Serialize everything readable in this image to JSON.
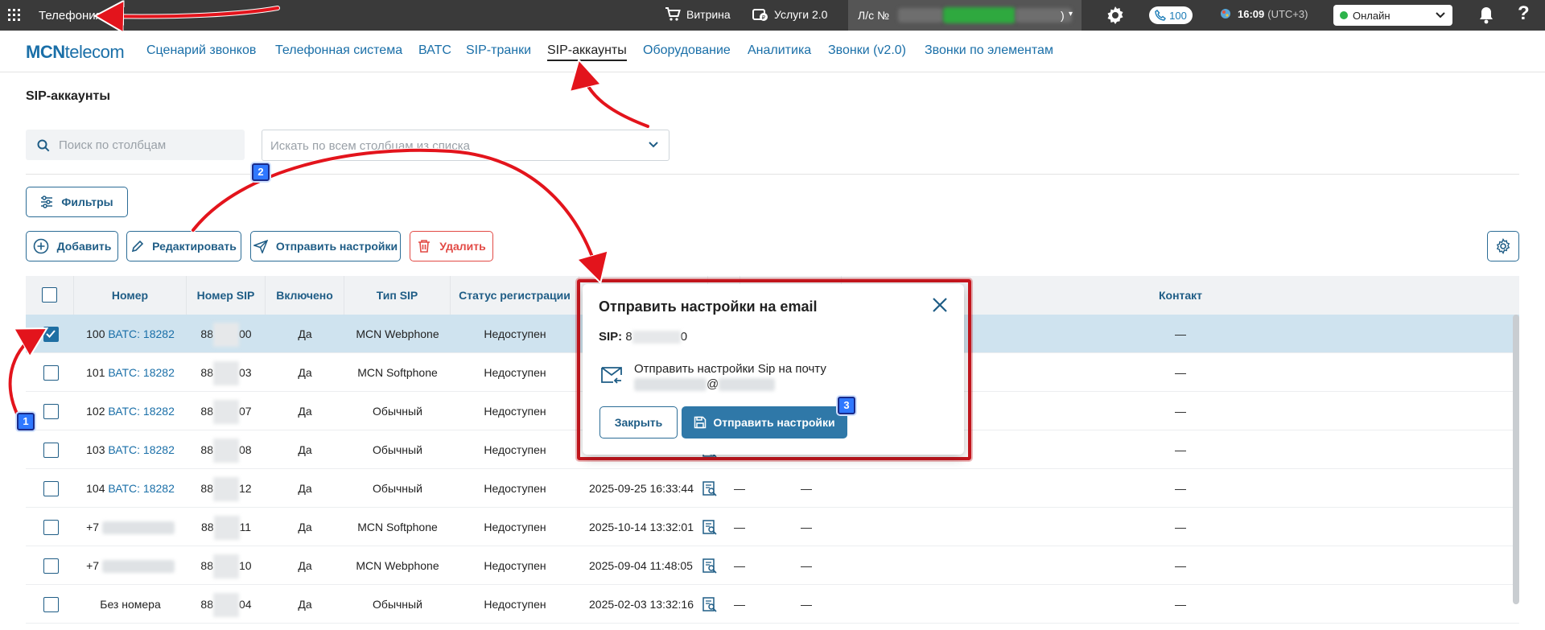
{
  "topbar": {
    "app_title": "Телефония",
    "showcase": "Витрина",
    "services": "Услуги 2.0",
    "account_prefix": "Л/с №",
    "account_suffix": ")",
    "calls_count": "100",
    "time": "16:09",
    "timezone": "(UTC+3)",
    "status": "Онлайн",
    "help": "?"
  },
  "brand": {
    "bold": "MCN",
    "rest": "telecom"
  },
  "nav": {
    "items": [
      "Сценарий звонков",
      "Телефонная система",
      "ВАТС",
      "SIP-транки",
      "SIP-аккаунты",
      "Оборудование",
      "Аналитика",
      "Звонки (v2.0)",
      "Звонки по элементам"
    ]
  },
  "page": {
    "title": "SIP-аккаунты",
    "search_placeholder": "Поиск по столбцам",
    "columns_select_placeholder": "Искать по всем столбцам из списка"
  },
  "toolbar": {
    "filters": "Фильтры",
    "add": "Добавить",
    "edit": "Редактировать",
    "send_settings": "Отправить настройки",
    "delete": "Удалить"
  },
  "table": {
    "headers": {
      "number": "Номер",
      "sip_number": "Номер SIP",
      "enabled": "Включено",
      "sip_type": "Тип SIP",
      "reg_status": "Статус регистрации",
      "contact": "Контакт"
    },
    "rows": [
      {
        "checked": true,
        "num": "100",
        "link": "ВАТС: 18282",
        "sip_a": "88",
        "sip_b": "00",
        "enabled": "Да",
        "type": "MCN Webphone",
        "status": "Недоступен",
        "date": "",
        "c1": "",
        "c2": "",
        "contact": "—"
      },
      {
        "checked": false,
        "num": "101",
        "link": "ВАТС: 18282",
        "sip_a": "88",
        "sip_b": "03",
        "enabled": "Да",
        "type": "MCN Softphone",
        "status": "Недоступен",
        "date": "",
        "c1": "",
        "c2": "",
        "contact": "—"
      },
      {
        "checked": false,
        "num": "102",
        "link": "ВАТС: 18282",
        "sip_a": "88",
        "sip_b": "07",
        "enabled": "Да",
        "type": "Обычный",
        "status": "Недоступен",
        "date": "",
        "c1": "",
        "c2": "",
        "contact": "—"
      },
      {
        "checked": false,
        "num": "103",
        "link": "ВАТС: 18282",
        "sip_a": "88",
        "sip_b": "08",
        "enabled": "Да",
        "type": "Обычный",
        "status": "Недоступен",
        "date": "",
        "c1": "",
        "c2": "",
        "contact": "—"
      },
      {
        "checked": false,
        "num": "104",
        "link": "ВАТС: 18282",
        "sip_a": "88",
        "sip_b": "12",
        "enabled": "Да",
        "type": "Обычный",
        "status": "Недоступен",
        "date": "2025-09-25 16:33:44",
        "c1": "—",
        "c2": "—",
        "contact": "—"
      },
      {
        "checked": false,
        "num": "+7",
        "link": "",
        "sip_a": "88",
        "sip_b": "11",
        "enabled": "Да",
        "type": "MCN Softphone",
        "status": "Недоступен",
        "date": "2025-10-14 13:32:01",
        "c1": "—",
        "c2": "—",
        "contact": "—"
      },
      {
        "checked": false,
        "num": "+7",
        "link": "",
        "sip_a": "88",
        "sip_b": "10",
        "enabled": "Да",
        "type": "MCN Webphone",
        "status": "Недоступен",
        "date": "2025-09-04 11:48:05",
        "c1": "—",
        "c2": "—",
        "contact": "—"
      },
      {
        "checked": false,
        "num": "Без номера",
        "link": "",
        "sip_a": "88",
        "sip_b": "04",
        "enabled": "Да",
        "type": "Обычный",
        "status": "Недоступен",
        "date": "2025-02-03 13:32:16",
        "c1": "—",
        "c2": "—",
        "contact": "—"
      }
    ]
  },
  "modal": {
    "title": "Отправить настройки на email",
    "sip_label": "SIP:",
    "sip_a": "8",
    "sip_b": "0",
    "mail_text": "Отправить настройки Sip на почту",
    "at": "@",
    "close_label": "Закрыть",
    "send_label": "Отправить настройки"
  },
  "annotations": {
    "b1": "1",
    "b2": "2",
    "b3": "3"
  },
  "colors": {
    "accent": "#1f5d86",
    "link": "#1a6fa8",
    "danger": "#e24a45",
    "annotation_red": "#e3141c",
    "selected_row": "#cfe3ef"
  }
}
